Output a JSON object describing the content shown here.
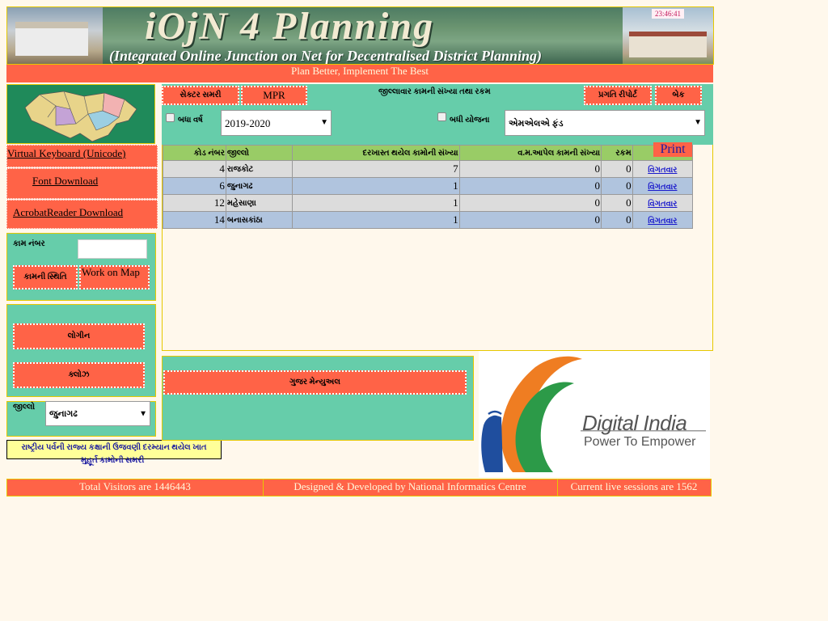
{
  "header": {
    "title": "iOjN 4 Planning",
    "subtitle": "(Integrated Online Junction on Net for Decentralised District Planning)",
    "clock": "23:46:41",
    "tagline": "Plan Better, Implement The Best"
  },
  "sidebar": {
    "virtual_keyboard": "Virtual Keyboard (Unicode)",
    "font_download": "Font Download",
    "acrobat_download": "AcrobatReader Download",
    "work_number_label": "કામ નંબર",
    "work_number_value": "",
    "work_status_button": "કામની સ્થિતિ",
    "work_on_map_button": "Work on Map",
    "login_button": "લોગીન",
    "close_button": "ક્લોઝ",
    "district_label": "જીલ્લો",
    "district_selected": "જુનાગઢ",
    "rashtriya_line1": "રાષ્ટ્રીય પર્વની રાજ્ય કક્ષાની ઉજવણી દરમ્યાન થયેલ ખાત",
    "rashtriya_line2": "મુહૂર્ત કામોની સમરી"
  },
  "main": {
    "sector_summary_button": "સેક્ટર સમરી",
    "mpr_button": "MPR",
    "page_title": "જીલ્લાવાર કામની સંખ્યા તથા રકમ",
    "progress_report_button": "પ્રગતિ રીપોર્ટ",
    "back_button": "બેક",
    "all_years_label": "બધા વર્ષ",
    "year_selected": "2019-2020",
    "all_schemes_label": "બધી યોજના",
    "scheme_selected": "એમએલએ ફંડ",
    "print_button": "Print",
    "columns": {
      "code": "કોડ નંબર",
      "district": "જીલ્લો",
      "applied": "દરખાસ્ત થયેલ કામોની સંખ્યા",
      "approved": "વ.મ.આપેલ કામની સંખ્યા",
      "amount": "રકમ"
    },
    "rows": [
      {
        "code": "4",
        "district": "રાજકોટ",
        "applied": "7",
        "approved": "0",
        "amount": "0",
        "link": "વિગતવાર"
      },
      {
        "code": "6",
        "district": "જુનાગઢ",
        "applied": "1",
        "approved": "0",
        "amount": "0",
        "link": "વિગતવાર"
      },
      {
        "code": "12",
        "district": "મહેસાણા",
        "applied": "1",
        "approved": "0",
        "amount": "0",
        "link": "વિગતવાર"
      },
      {
        "code": "14",
        "district": "બનાસકાંઠા",
        "applied": "1",
        "approved": "0",
        "amount": "0",
        "link": "વિગતવાર"
      }
    ],
    "manual_button": "ગુજર મેન્યુઅલ"
  },
  "digital_india": {
    "title": "Digital India",
    "tagline": "Power To Empower"
  },
  "footer": {
    "visitors": "Total Visitors are 1446443",
    "credits": "Designed & Developed by National Informatics Centre",
    "sessions": "Current live sessions are 1562"
  },
  "colors": {
    "accent_red": "#ff6347",
    "panel_teal": "#66cdaa",
    "header_green": "#99cc66",
    "link_blue": "#1a1acc"
  }
}
